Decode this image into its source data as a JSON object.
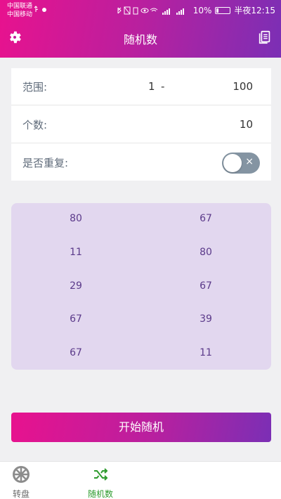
{
  "status_bar": {
    "carrier1": "中国联通",
    "carrier2": "中国移动",
    "battery": "10%",
    "time": "半夜12:15"
  },
  "header": {
    "title": "随机数",
    "gradient_start": "#e8128e",
    "gradient_end": "#7b2fb5"
  },
  "settings": {
    "range_label": "范围:",
    "range_min": "1",
    "range_sep": "-",
    "range_max": "100",
    "count_label": "个数:",
    "count_value": "10",
    "repeat_label": "是否重复:",
    "repeat_toggle_on": false,
    "repeat_toggle_icon": "×"
  },
  "results": {
    "left": [
      "80",
      "11",
      "29",
      "67",
      "67"
    ],
    "right": [
      "67",
      "80",
      "67",
      "39",
      "11"
    ],
    "background": "#e2d7ef"
  },
  "start_button": {
    "label": "开始随机"
  },
  "bottom_nav": {
    "items": [
      {
        "label": "转盘",
        "icon": "wheel-icon",
        "active": false
      },
      {
        "label": "随机数",
        "icon": "shuffle-icon",
        "active": true
      }
    ],
    "active_color": "#2e9b2e",
    "inactive_color": "#6a6a6a"
  }
}
